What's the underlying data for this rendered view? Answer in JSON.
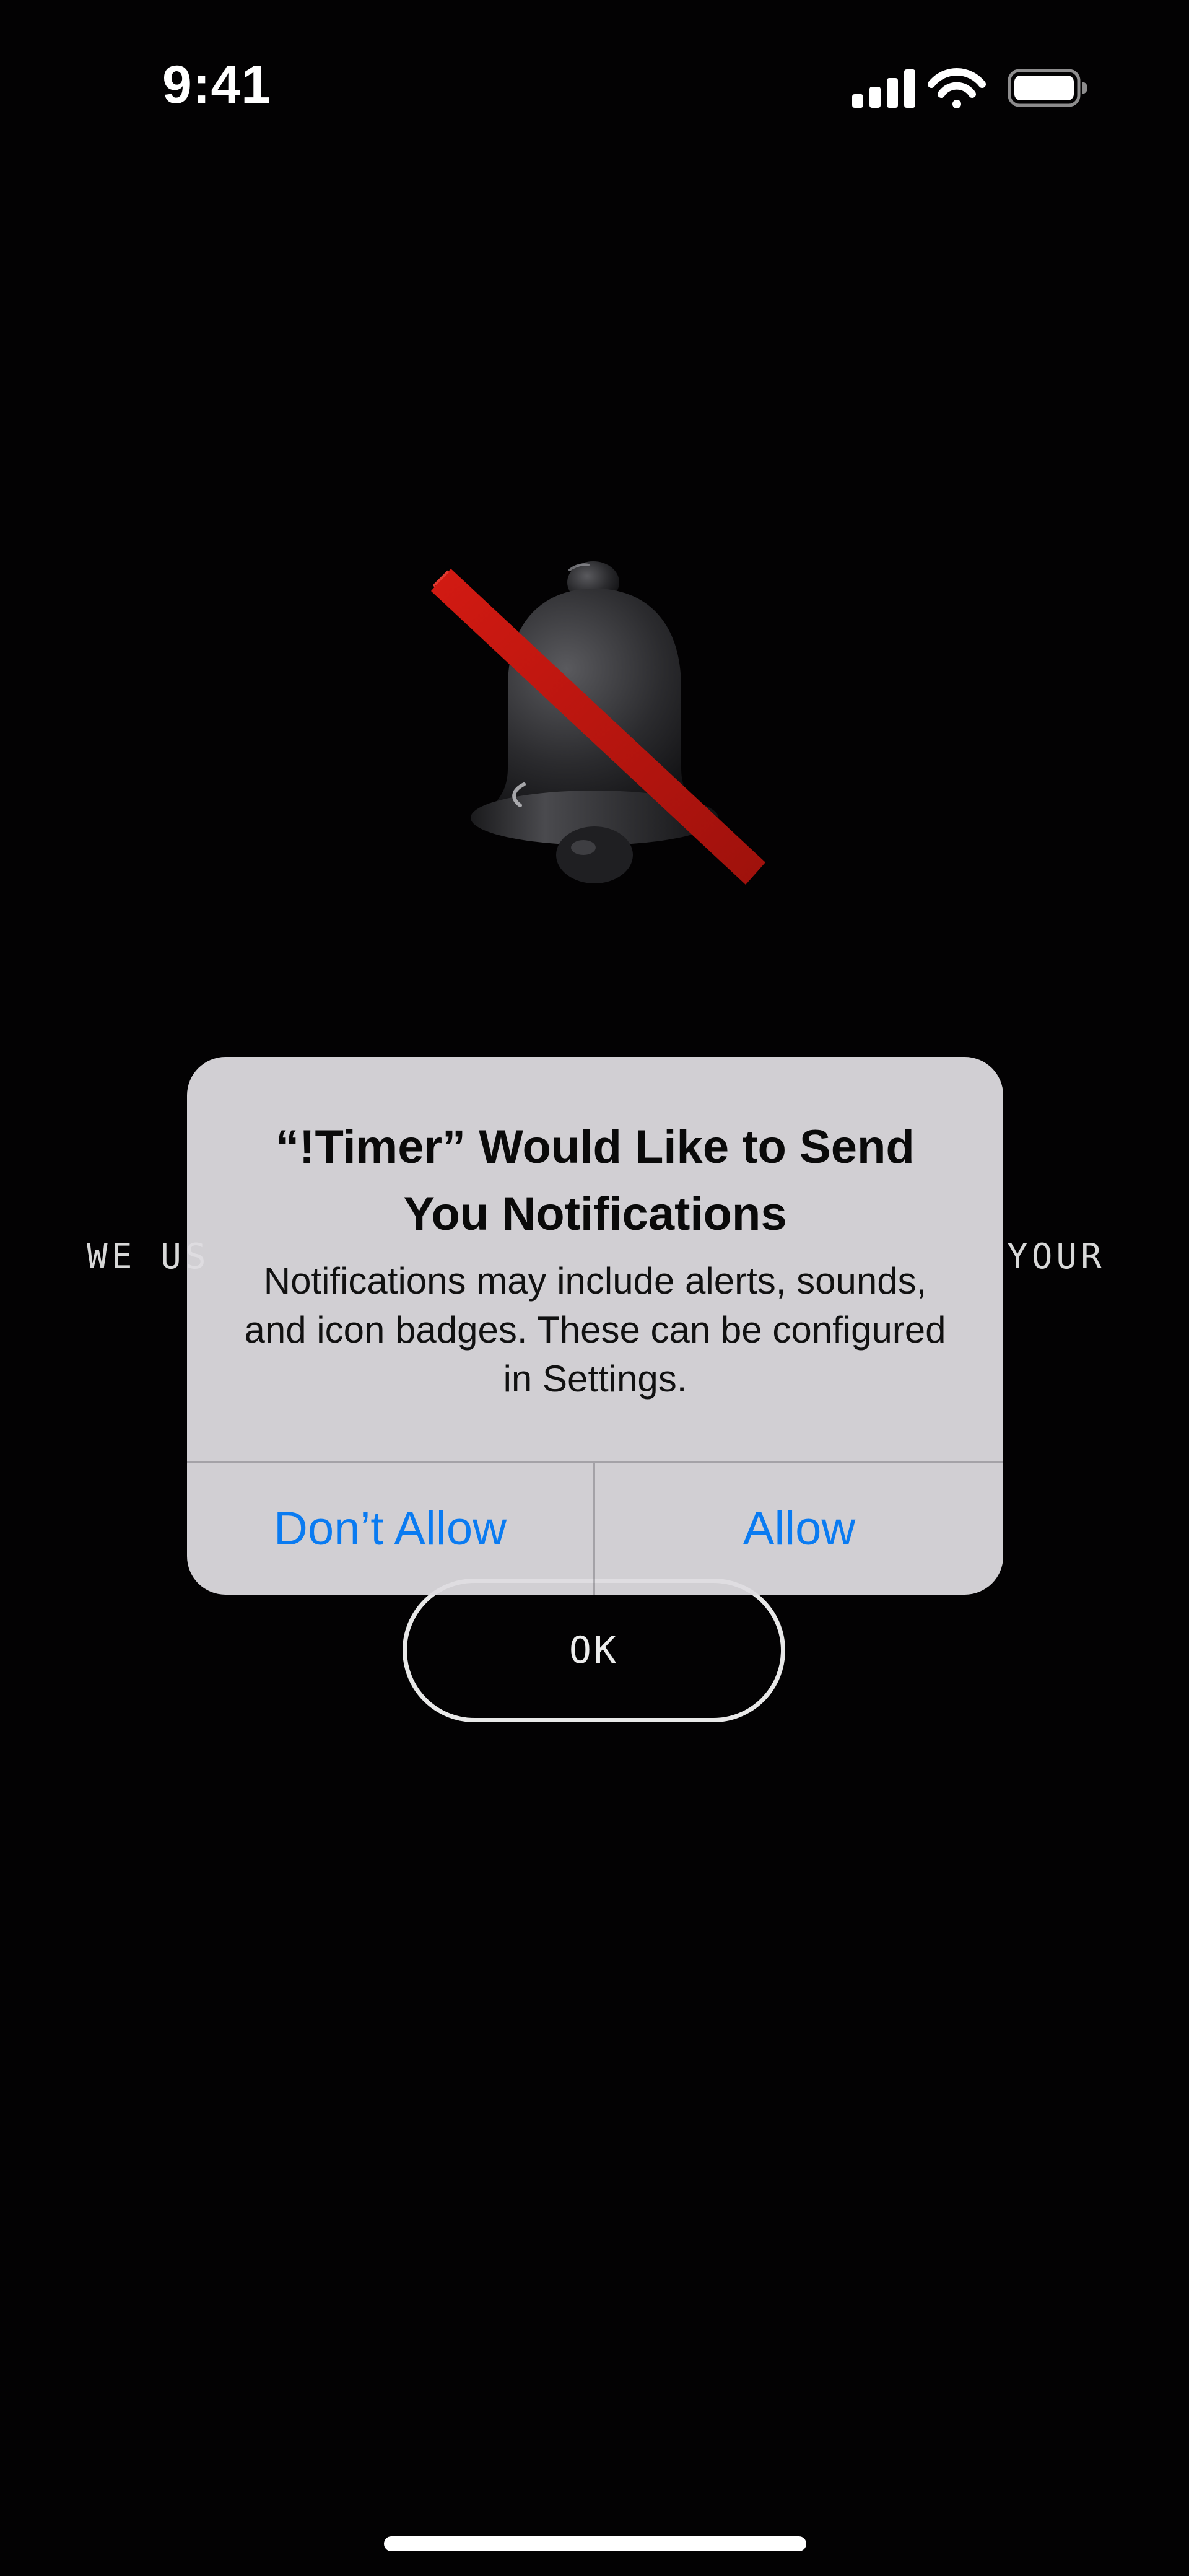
{
  "status_bar": {
    "time": "9:41",
    "icons": [
      "signal-icon",
      "wifi-icon",
      "battery-icon"
    ]
  },
  "background": {
    "illustration": "bell-crossed-out-icon",
    "message_left_fragment": "WE US",
    "message_right_fragment": "YOUR",
    "ok_label": "OK"
  },
  "alert": {
    "title": "“!Timer” Would Like to Send You Notifications",
    "message": "Notifications may include alerts, sounds, and icon badges. These can be configured in Settings.",
    "dont_allow_label": "Don’t Allow",
    "allow_label": "Allow"
  },
  "colors": {
    "background": "#030203",
    "alert_button_blue": "#0a7bf1",
    "slash_red": "#b3140f"
  }
}
